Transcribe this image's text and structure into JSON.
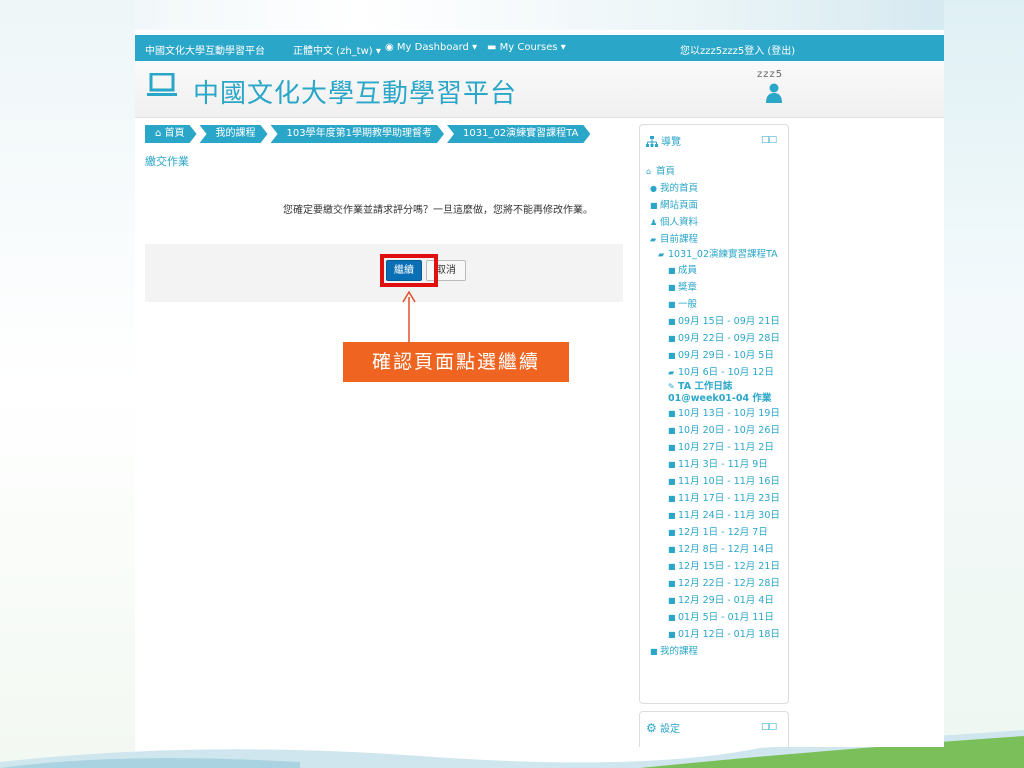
{
  "navbar": {
    "site": "中國文化大學互動學習平台",
    "language": "正體中文 (zh_tw)",
    "dashboard": "My Dashboard",
    "courses": "My Courses",
    "login_status": "您以zzz5zzz5登入 (登出)"
  },
  "header": {
    "title": "中國文化大學互動學習平台",
    "user_name": "zzz5"
  },
  "breadcrumb": [
    "首頁",
    "我的課程",
    "103學年度第1學期教學助理督考",
    "1031_02演練實習課程TA"
  ],
  "main": {
    "heading": "繳交作業",
    "confirm_message": "您確定要繳交作業並請求評分嗎？一旦這麼做，您將不能再修改作業。",
    "continue_label": "繼續",
    "cancel_label": "取消"
  },
  "annotation": {
    "callout": "確認頁面點選繼續",
    "highlight_color": "#e01010",
    "callout_color": "#ef6420"
  },
  "navigation_block": {
    "title": "導覽",
    "items": [
      {
        "label": "首頁",
        "icon": "home-icon",
        "level": 0
      },
      {
        "label": "我的首頁",
        "icon": "circle-icon",
        "level": 1
      },
      {
        "label": "網站頁面",
        "icon": "folder-icon",
        "level": 1
      },
      {
        "label": "個人資料",
        "icon": "user-icon",
        "level": 1
      },
      {
        "label": "目前課程",
        "icon": "folder-open-icon",
        "level": 1
      },
      {
        "label": "1031_02演練實習課程TA",
        "icon": "folder-open-icon",
        "level": 2
      },
      {
        "label": "成員",
        "icon": "folder-icon",
        "level": 3
      },
      {
        "label": "獎章",
        "icon": "folder-icon",
        "level": 3
      },
      {
        "label": "一般",
        "icon": "folder-icon",
        "level": 3
      },
      {
        "label": "09月 15日 - 09月 21日",
        "icon": "folder-icon",
        "level": 3
      },
      {
        "label": "09月 22日 - 09月 28日",
        "icon": "folder-icon",
        "level": 3
      },
      {
        "label": "09月 29日 - 10月 5日",
        "icon": "folder-icon",
        "level": 3
      },
      {
        "label": "10月 6日 - 10月 12日",
        "icon": "folder-open-icon",
        "level": 3
      },
      {
        "label": "TA 工作日誌 01@week01-04 作業",
        "icon": "assignment-icon",
        "level": 4
      },
      {
        "label": "10月 13日 - 10月 19日",
        "icon": "folder-icon",
        "level": 3
      },
      {
        "label": "10月 20日 - 10月 26日",
        "icon": "folder-icon",
        "level": 3
      },
      {
        "label": "10月 27日 - 11月 2日",
        "icon": "folder-icon",
        "level": 3
      },
      {
        "label": "11月 3日 - 11月 9日",
        "icon": "folder-icon",
        "level": 3
      },
      {
        "label": "11月 10日 - 11月 16日",
        "icon": "folder-icon",
        "level": 3
      },
      {
        "label": "11月 17日 - 11月 23日",
        "icon": "folder-icon",
        "level": 3
      },
      {
        "label": "11月 24日 - 11月 30日",
        "icon": "folder-icon",
        "level": 3
      },
      {
        "label": "12月 1日 - 12月 7日",
        "icon": "folder-icon",
        "level": 3
      },
      {
        "label": "12月 8日 - 12月 14日",
        "icon": "folder-icon",
        "level": 3
      },
      {
        "label": "12月 15日 - 12月 21日",
        "icon": "folder-icon",
        "level": 3
      },
      {
        "label": "12月 22日 - 12月 28日",
        "icon": "folder-icon",
        "level": 3
      },
      {
        "label": "12月 29日 - 01月 4日",
        "icon": "folder-icon",
        "level": 3
      },
      {
        "label": "01月 5日 - 01月 11日",
        "icon": "folder-icon",
        "level": 3
      },
      {
        "label": "01月 12日 - 01月 18日",
        "icon": "folder-icon",
        "level": 3
      },
      {
        "label": "我的課程",
        "icon": "folder-icon",
        "level": 1
      }
    ]
  },
  "settings_block": {
    "title": "設定"
  },
  "colors": {
    "accent": "#2aa6c8",
    "button": "#0a6fb5"
  }
}
